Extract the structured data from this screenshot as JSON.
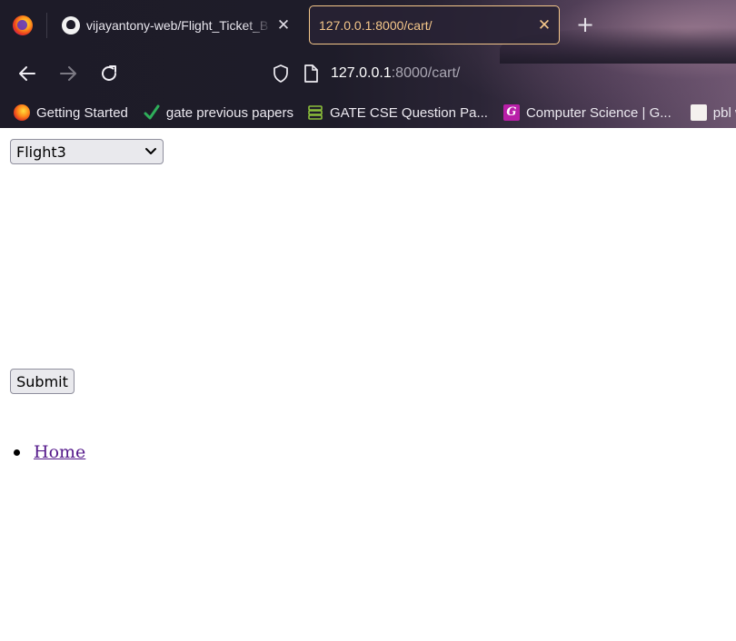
{
  "browser": {
    "tabs": [
      {
        "title": "vijayantony-web/Flight_Ticket_B",
        "close": "✕",
        "active": false
      },
      {
        "title": "127.0.0.1:8000/cart/",
        "close": "✕",
        "active": true
      }
    ],
    "new_tab": "+",
    "icons": {
      "firefox": "firefox-icon",
      "github": "github-icon",
      "back": "back-arrow-icon",
      "forward": "forward-arrow-icon",
      "reload": "reload-icon",
      "shield": "tracking-shield-icon",
      "page": "page-icon"
    },
    "url": {
      "host": "127.0.0.1",
      "rest": ":8000/cart/"
    },
    "bookmarks": [
      {
        "label": "Getting Started",
        "icon": "firefox-icon"
      },
      {
        "label": "gate previous papers",
        "icon": "checkmark-icon"
      },
      {
        "label": "GATE CSE Question Pa...",
        "icon": "stack-icon"
      },
      {
        "label": "Computer Science | G...",
        "icon": "g-icon",
        "icon_glyph": "G"
      },
      {
        "label": "pbl wip",
        "icon": "pdf-thumbnail-icon"
      }
    ],
    "colors": {
      "active_tab_accent": "#f5c78a",
      "chrome_bg": "#1d1b28"
    }
  },
  "page": {
    "flight_select": {
      "selected": "Flight3"
    },
    "submit_label": "Submit",
    "nav": [
      {
        "label": "Home"
      }
    ],
    "colors": {
      "link_visited": "#551a8b",
      "control_bg": "#e9e9ed"
    }
  }
}
